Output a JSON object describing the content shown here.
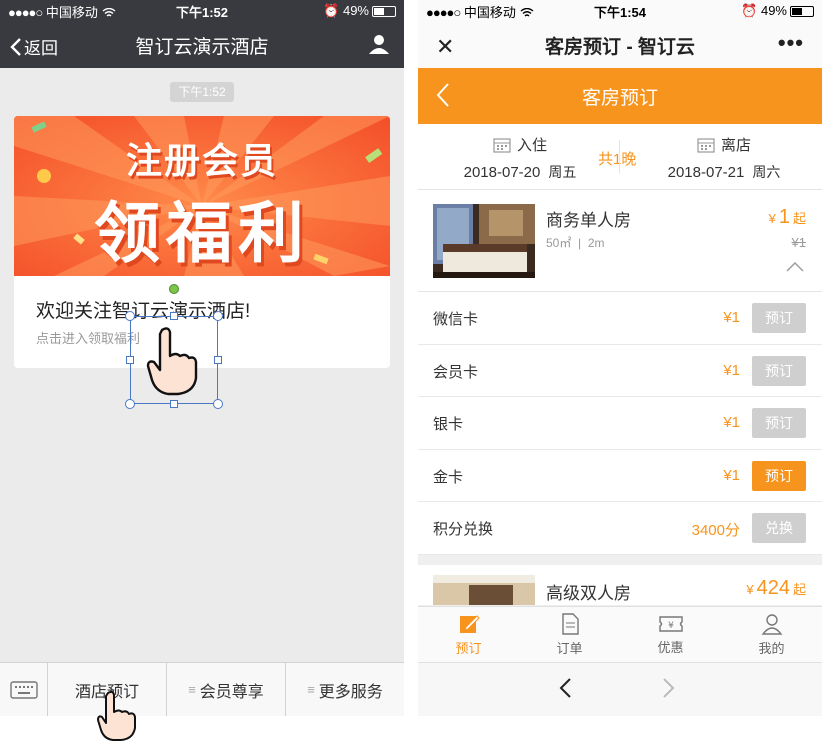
{
  "left": {
    "status": {
      "carrier": "中国移动",
      "time": "下午1:52",
      "battery": "49%"
    },
    "nav": {
      "back": "返回",
      "title": "智订云演示酒店"
    },
    "message_time": "下午1:52",
    "card": {
      "banner_line1": "注册会员",
      "banner_line2": "领福利",
      "title": "欢迎关注智订云演示酒店!",
      "subtitle": "点击进入领取福利"
    },
    "menu": [
      {
        "label": "酒店预订"
      },
      {
        "label": "会员尊享"
      },
      {
        "label": "更多服务"
      }
    ],
    "icons": [
      "keyboard-icon",
      "hand-pointer-icon",
      "user-icon",
      "wifi-icon",
      "alarm-icon",
      "battery-icon"
    ]
  },
  "right": {
    "status": {
      "carrier": "中国移动",
      "time": "下午1:54",
      "battery": "49%"
    },
    "nav": {
      "title": "客房预订 - 智订云"
    },
    "bar_title": "客房预订",
    "dates": {
      "checkin_label": "入住",
      "checkin_date": "2018-07-20",
      "checkin_weekday": "周五",
      "nights": "共1晚",
      "checkout_label": "离店",
      "checkout_date": "2018-07-21",
      "checkout_weekday": "周六"
    },
    "room1": {
      "name": "商务单人房",
      "area": "50㎡",
      "bed": "2m",
      "currency": "¥",
      "price": "1",
      "from": "起",
      "original_price": "¥1"
    },
    "rates": [
      {
        "name": "微信卡",
        "price": "¥1",
        "button": "预订",
        "active": false
      },
      {
        "name": "会员卡",
        "price": "¥1",
        "button": "预订",
        "active": false
      },
      {
        "name": "银卡",
        "price": "¥1",
        "button": "预订",
        "active": false
      },
      {
        "name": "金卡",
        "price": "¥1",
        "button": "预订",
        "active": true
      },
      {
        "name": "积分兑换",
        "price": "3400分",
        "button": "兑换",
        "active": false
      }
    ],
    "room2": {
      "name": "高级双人房",
      "currency": "¥",
      "price": "424",
      "from": "起"
    },
    "tabs": [
      {
        "label": "预订",
        "active": true
      },
      {
        "label": "订单",
        "active": false
      },
      {
        "label": "优惠",
        "active": false
      },
      {
        "label": "我的",
        "active": false
      }
    ],
    "accent_color": "#f7941d"
  }
}
